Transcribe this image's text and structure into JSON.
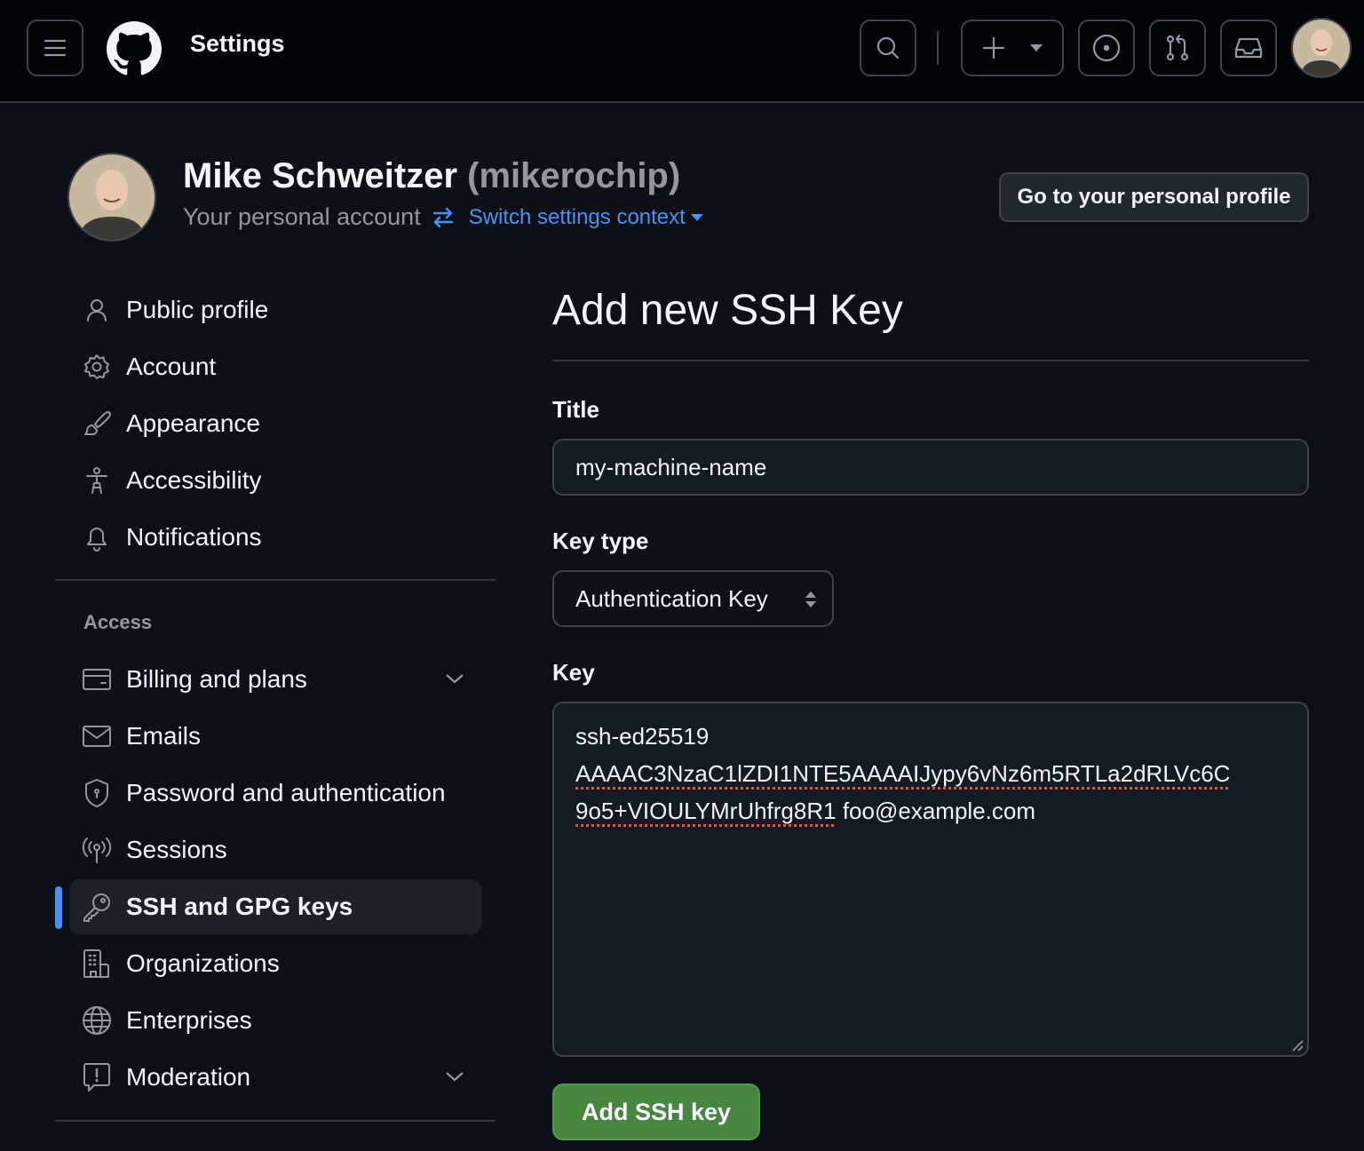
{
  "header": {
    "title": "Settings",
    "icons": {
      "menu": "hamburger-icon",
      "logo": "github-mark-icon",
      "search": "search-icon",
      "create": "plus-icon",
      "create_dropdown": "triangle-down-icon",
      "issues": "issue-opened-icon",
      "pulls": "git-pull-request-icon",
      "inbox": "inbox-icon"
    }
  },
  "profile": {
    "name": "Mike Schweitzer",
    "login": "(mikerochip)",
    "subtitle": "Your personal account",
    "switch_label": "Switch settings context",
    "go_to_profile_label": "Go to your personal profile"
  },
  "sidebar": {
    "items": [
      {
        "label": "Public profile",
        "icon": "person-icon"
      },
      {
        "label": "Account",
        "icon": "gear-icon"
      },
      {
        "label": "Appearance",
        "icon": "paintbrush-icon"
      },
      {
        "label": "Accessibility",
        "icon": "accessibility-icon"
      },
      {
        "label": "Notifications",
        "icon": "bell-icon"
      }
    ],
    "access_heading": "Access",
    "access_items": [
      {
        "label": "Billing and plans",
        "icon": "credit-card-icon",
        "expandable": true
      },
      {
        "label": "Emails",
        "icon": "mail-icon"
      },
      {
        "label": "Password and authentication",
        "icon": "shield-lock-icon"
      },
      {
        "label": "Sessions",
        "icon": "broadcast-icon"
      },
      {
        "label": "SSH and GPG keys",
        "icon": "key-icon",
        "active": true
      },
      {
        "label": "Organizations",
        "icon": "organization-icon"
      },
      {
        "label": "Enterprises",
        "icon": "globe-icon"
      },
      {
        "label": "Moderation",
        "icon": "report-icon",
        "expandable": true
      }
    ]
  },
  "form": {
    "heading": "Add new SSH Key",
    "title_label": "Title",
    "title_value": "my-machine-name",
    "key_type_label": "Key type",
    "key_type_value": "Authentication Key",
    "key_label": "Key",
    "key_value_lines": [
      "ssh-ed25519",
      "AAAAC3NzaC1lZDI1NTE5AAAAIJypy6vNz6m5RTLa2dRLVc6C",
      "9o5+VIOULYMrUhfrg8R1"
    ],
    "key_value_email": "foo@example.com",
    "submit_label": "Add SSH key"
  },
  "colors": {
    "accent": "#4493f8",
    "success": "#468641",
    "background": "#0d1117"
  }
}
